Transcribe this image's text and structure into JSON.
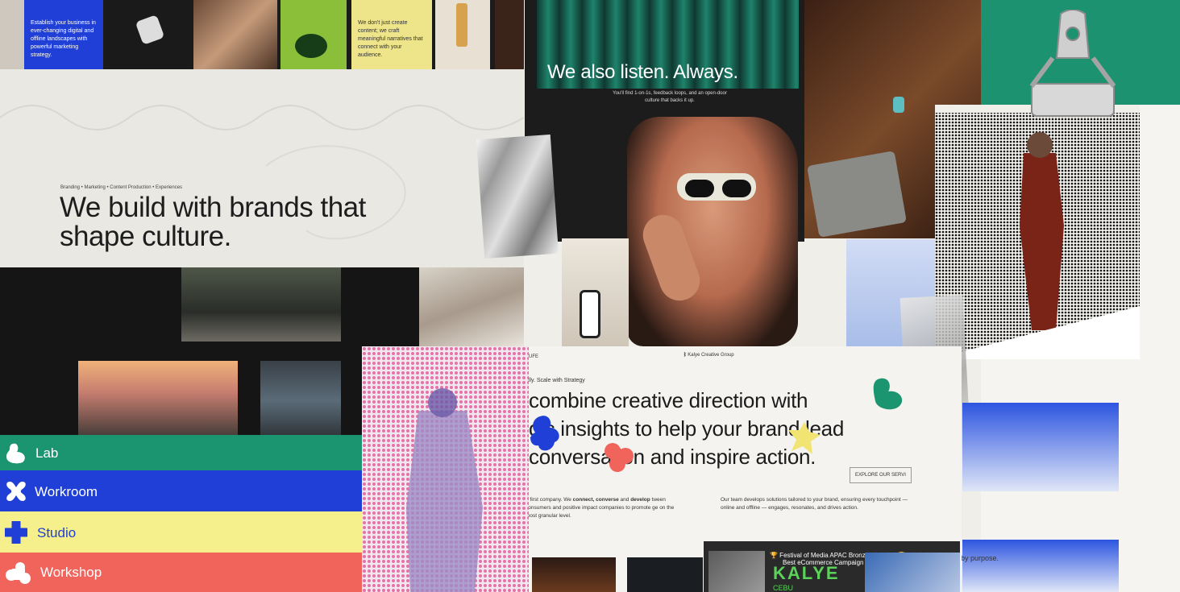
{
  "top_strip": {
    "tile_blue_text": "Establish your business in ever-changing digital and offline landscapes with powerful marketing strategy.",
    "tile_yellow_text": "We don't just create content; we craft meaningful narratives that connect with your audience."
  },
  "hero": {
    "tags": "Branding • Marketing • Content Production • Experiences",
    "title_line1": "We build with brands that",
    "title_line2": "shape culture."
  },
  "listen_panel": {
    "title": "We also listen. Always.",
    "subtitle": "You'll find 1-on-1s, feedback loops, and an open-door culture that backs it up."
  },
  "categories": [
    {
      "label": "Lab",
      "color": "#1b9470",
      "icon": "lab-blob-icon"
    },
    {
      "label": "Workroom",
      "color": "#1f3fd6",
      "icon": "workroom-x-icon"
    },
    {
      "label": "Studio",
      "color": "#f5ef8c",
      "text_color": "#1f3fd6",
      "icon": "studio-plus-icon"
    },
    {
      "label": "Workshop",
      "color": "#f0645c",
      "icon": "workshop-cluster-icon"
    }
  ],
  "white_page": {
    "nav_fragment": "UFE",
    "brand": "Kalye Creative Group",
    "kicker": "ally. Scale with Strategy",
    "headline_line1": "combine creative direction with",
    "headline_line2": "gic insights to help your brand lead",
    "headline_line3": "conversation and inspire action.",
    "explore_label": "EXPLORE OUR SERVI",
    "paragraph_left_pre": "e first company. We ",
    "paragraph_left_bold1": "connect, converse",
    "paragraph_left_mid": " and ",
    "paragraph_left_bold2": "develop",
    "paragraph_left_post": " tween consumers and positive impact companies to promote ge on the most granular level.",
    "paragraph_right": "Our team develops solutions tailored to your brand, ensuring every touchpoint — online and offline — engages, resonates, and drives action."
  },
  "award": {
    "line1": "🏆 Festival of Media APAC Bronze Awardee 🏆",
    "line2": "Best eCommerce Campaign",
    "logo": "KALYE",
    "sub": "CEBU"
  },
  "right_page": {
    "purpose_text": "by purpose."
  },
  "colors": {
    "green": "#1b9470",
    "blue": "#1f3fd6",
    "yellow": "#f5ef8c",
    "coral": "#f0645c"
  }
}
